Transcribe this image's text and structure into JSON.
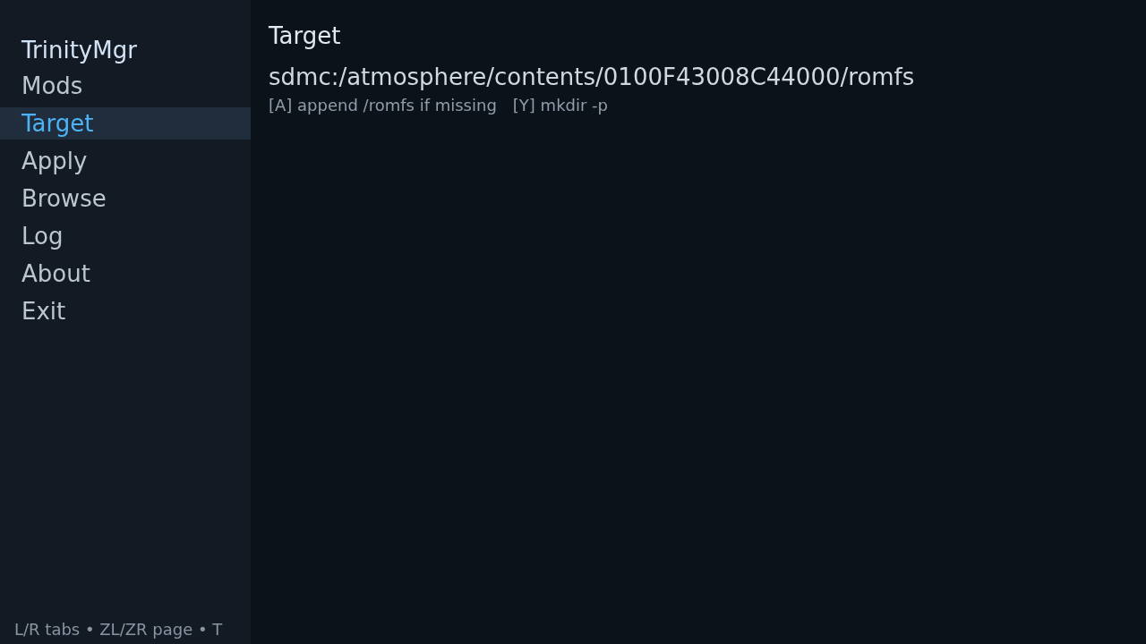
{
  "sidebar": {
    "title": "TrinityMgr",
    "items": [
      {
        "label": "Mods",
        "selected": false
      },
      {
        "label": "Target",
        "selected": true
      },
      {
        "label": "Apply",
        "selected": false
      },
      {
        "label": "Browse",
        "selected": false
      },
      {
        "label": "Log",
        "selected": false
      },
      {
        "label": "About",
        "selected": false
      },
      {
        "label": "Exit",
        "selected": false
      }
    ],
    "footer": "L/R tabs • ZL/ZR page • T"
  },
  "main": {
    "heading": "Target",
    "path": "sdmc:/atmosphere/contents/0100F43008C44000/romfs",
    "hints": [
      "[A] append /romfs if missing",
      "[Y] mkdir -p"
    ]
  }
}
